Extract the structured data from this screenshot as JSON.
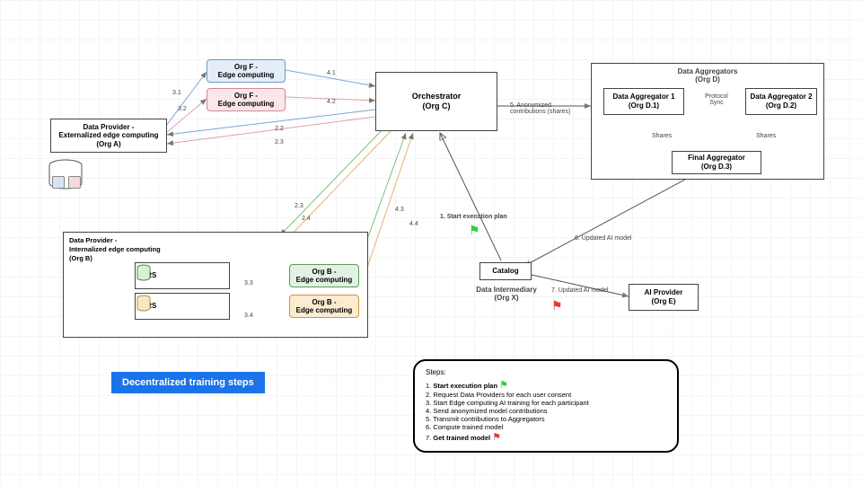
{
  "banner": "Decentralized training steps",
  "nodes": {
    "orgF_blue": "Org F - \nEdge computing",
    "orgF_pink": "Org F - \nEdge computing",
    "orgA": "Data Provider - \nExternalized edge computing\n(Org A)",
    "orchestrator": "Orchestrator\n(Org C)",
    "aggGroup": "Data Aggregators\n(Org D)",
    "agg1": "Data Aggregator 1\n(Org D.1)",
    "agg2": "Data Aggregator 2\n(Org D.2)",
    "aggFinal": "Final Aggregator\n(Org D.3)",
    "orgB_container_t1": "Data Provider -",
    "orgB_container_t2": "Internalized edge computing",
    "orgB_container_t3": "(Org B)",
    "plrs1": "PLRS",
    "plrs2": "PLRS",
    "orgB_green": "Org B - \nEdge computing",
    "orgB_orange": "Org B - \nEdge computing",
    "catalog": "Catalog",
    "dataIntermediary": "Data Intermediary\n(Org X)",
    "aiProvider": "AI Provider\n(Org E)"
  },
  "labels": {
    "l31": "3.1",
    "l32": "3.2",
    "l22": "2.2",
    "l23a": "2.3",
    "l23b": "2.3",
    "l24": "2.4",
    "l33": "3.3",
    "l34": "3.4",
    "l41": "4.1",
    "l42": "4.2",
    "l43": "4.3",
    "l44": "4.4",
    "l5": "5. Anonymized\ncontributions (shares)",
    "protoSync": "Protocol\nSync",
    "shares1": "Shares",
    "shares2": "Shares",
    "l1": "1. Start execution plan",
    "l6": "6. Updated AI model",
    "l7": "7. Updated AI model"
  },
  "steps": {
    "title": "Steps:",
    "s1": "1.",
    "s1t": "Start execution plan",
    "s2": "2. Request Data Providers for each user consent",
    "s3": "3. Start Edge computing AI training for each participant",
    "s4": "4. Send anonymized model contributions",
    "s5": "5. Transmit contributions to Aggregators",
    "s6": "6. Compute trained model",
    "s7": "7.",
    "s7t": "Get trained model"
  },
  "chart_data": {
    "type": "diagram",
    "title": "Decentralized training steps",
    "entities": [
      {
        "id": "orgA",
        "label": "Data Provider - Externalized edge computing (Org A)"
      },
      {
        "id": "orgF_1",
        "label": "Org F - Edge computing",
        "color": "blue"
      },
      {
        "id": "orgF_2",
        "label": "Org F - Edge computing",
        "color": "pink"
      },
      {
        "id": "orgB",
        "label": "Data Provider - Internalized edge computing (Org B)",
        "children": [
          {
            "id": "plrs1",
            "label": "PLRS"
          },
          {
            "id": "plrs2",
            "label": "PLRS"
          },
          {
            "id": "orgB_edge1",
            "label": "Org B - Edge computing",
            "color": "green"
          },
          {
            "id": "orgB_edge2",
            "label": "Org B - Edge computing",
            "color": "orange"
          }
        ]
      },
      {
        "id": "orchestrator",
        "label": "Orchestrator (Org C)"
      },
      {
        "id": "aggGroup",
        "label": "Data Aggregators (Org D)",
        "children": [
          {
            "id": "agg1",
            "label": "Data Aggregator 1 (Org D.1)"
          },
          {
            "id": "agg2",
            "label": "Data Aggregator 2 (Org D.2)"
          },
          {
            "id": "aggFinal",
            "label": "Final Aggregator (Org D.3)"
          }
        ]
      },
      {
        "id": "dataIntermediary",
        "label": "Data Intermediary (Org X)",
        "children": [
          {
            "id": "catalog",
            "label": "Catalog"
          }
        ]
      },
      {
        "id": "aiProvider",
        "label": "AI Provider (Org E)"
      }
    ],
    "edges": [
      {
        "from": "orgA",
        "to": "orgF_1",
        "label": "3.1"
      },
      {
        "from": "orgA",
        "to": "orgF_2",
        "label": "3.2"
      },
      {
        "from": "orchestrator",
        "to": "orgA",
        "label": "2.2"
      },
      {
        "from": "orchestrator",
        "to": "orgA",
        "label": "2.3"
      },
      {
        "from": "orchestrator",
        "to": "orgB",
        "label": "2.3"
      },
      {
        "from": "orchestrator",
        "to": "orgB",
        "label": "2.4"
      },
      {
        "from": "plrs1",
        "to": "orgB_edge1",
        "label": "3.3"
      },
      {
        "from": "plrs2",
        "to": "orgB_edge2",
        "label": "3.4"
      },
      {
        "from": "orgF_1",
        "to": "orchestrator",
        "label": "4.1"
      },
      {
        "from": "orgF_2",
        "to": "orchestrator",
        "label": "4.2"
      },
      {
        "from": "orgB_edge1",
        "to": "orchestrator",
        "label": "4.3"
      },
      {
        "from": "orgB_edge2",
        "to": "orchestrator",
        "label": "4.4"
      },
      {
        "from": "orchestrator",
        "to": "aggGroup",
        "label": "5. Anonymized contributions (shares)"
      },
      {
        "from": "agg1",
        "to": "agg2",
        "label": "Protocol Sync",
        "style": "dashed"
      },
      {
        "from": "agg1",
        "to": "aggFinal",
        "label": "Shares"
      },
      {
        "from": "agg2",
        "to": "aggFinal",
        "label": "Shares"
      },
      {
        "from": "catalog",
        "to": "orchestrator",
        "label": "1. Start execution plan"
      },
      {
        "from": "aggFinal",
        "to": "catalog",
        "label": "6. Updated AI model"
      },
      {
        "from": "catalog",
        "to": "aiProvider",
        "label": "7. Updated AI model"
      }
    ],
    "steps": [
      "Start execution plan",
      "Request Data Providers for each user consent",
      "Start Edge computing AI training for each participant",
      "Send anonymized model contributions",
      "Transmit contributions to Aggregators",
      "Compute trained model",
      "Get trained model"
    ]
  }
}
